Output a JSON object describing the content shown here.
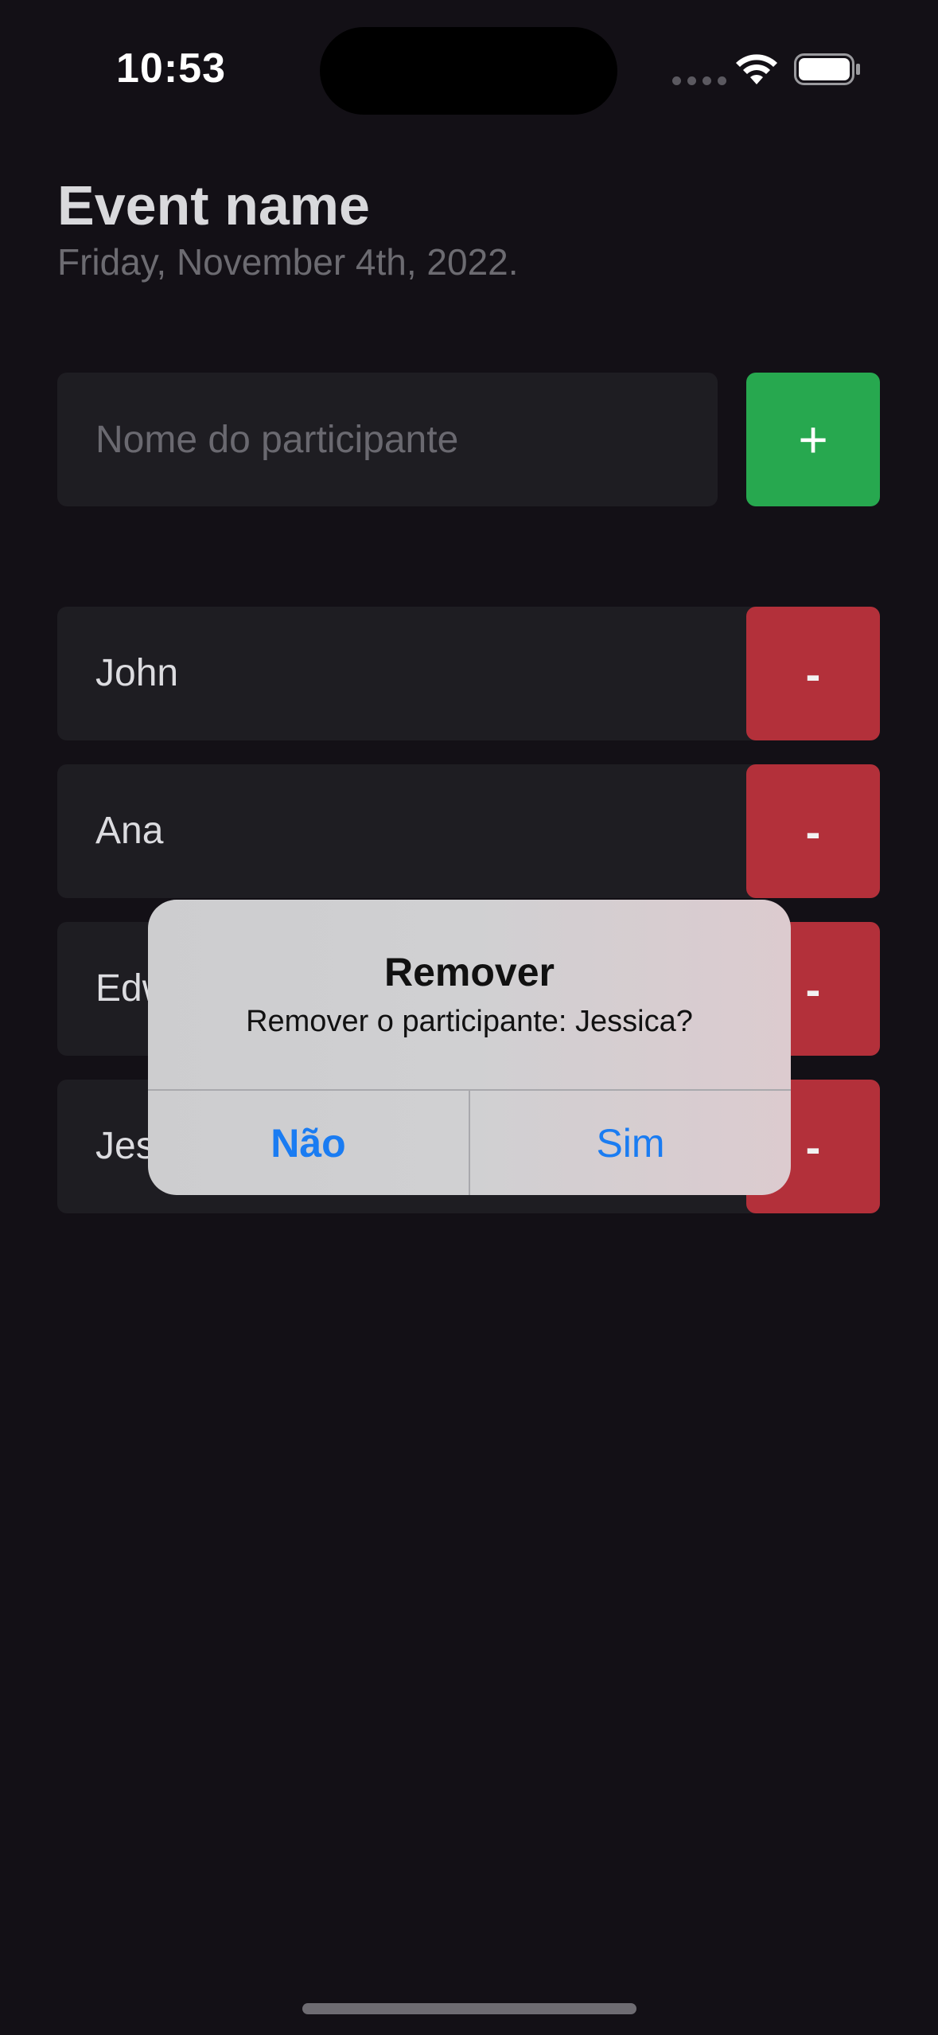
{
  "status_bar": {
    "time": "10:53",
    "wifi_icon": "wifi-icon",
    "battery_icon": "battery-icon"
  },
  "header": {
    "title": "Event name",
    "date": "Friday, November 4th, 2022."
  },
  "form": {
    "input_placeholder": "Nome do participante",
    "input_value": "",
    "add_label": "+"
  },
  "participants": [
    {
      "name": "John",
      "remove_label": "-"
    },
    {
      "name": "Ana",
      "remove_label": "-"
    },
    {
      "name": "Edward",
      "remove_label": "-"
    },
    {
      "name": "Jessica",
      "remove_label": "-"
    }
  ],
  "alert": {
    "title": "Remover",
    "message": "Remover o participante: Jessica?",
    "cancel_label": "Não",
    "confirm_label": "Sim"
  },
  "colors": {
    "background": "#131016",
    "card": "#1e1d22",
    "add_button": "#27a84f",
    "remove_button": "#b3303a",
    "alert_action": "#1a7cf2"
  }
}
